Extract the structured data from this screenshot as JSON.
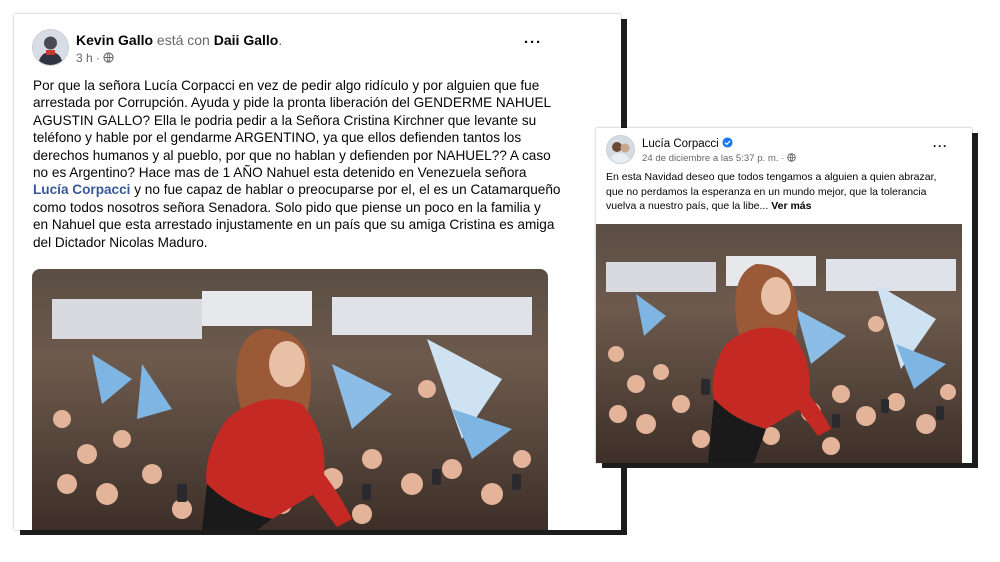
{
  "colors": {
    "link": "#385898",
    "text": "#050505",
    "muted": "#65676b",
    "verified": "#1877f2",
    "jacket_red": "#c42a23",
    "flag_blue": "#7fb5e3"
  },
  "post_left": {
    "author": "Kevin Gallo",
    "with_word": "está con",
    "tagged": "Daii Gallo",
    "period": ".",
    "time": "3 h ·",
    "privacy_icon": "globe-icon",
    "more_icon": "more-options-icon",
    "more_label": "···",
    "text_part1": "Por que la señora Lucía Corpacci en vez de pedir algo ridículo y por alguien que fue\narrestada por Corrupción. Ayuda y pide la pronta  liberación del GENDERME NAHUEL\nAGUSTIN GALLO? Ella le podria pedir a la Señora Cristina Kirchner que levante su\nteléfono y hable por el gendarme ARGENTINO, ya que ellos defienden tantos los\nderechos humanos y al pueblo, por que no hablan y defienden por NAHUEL?? A caso\nno es Argentino? Hace mas de 1 AÑO Nahuel esta detenido en Venezuela señora\n",
    "text_mention": "Lucía Corpacci",
    "text_part2": " y no fue capaz de hablar o preocuparse por el, el es un Catamarqueño\ncomo todos nosotros señora Senadora. Solo pido que piense un poco en la familia y\nen Nahuel que esta arrestado injustamente en un país que su amiga Cristina es amiga\ndel Dictador Nicolas Maduro.",
    "photo_icon": "rally-photo"
  },
  "post_right": {
    "author": "Lucía Corpacci",
    "verified_icon": "verified-badge-icon",
    "date": "24 de diciembre a las 5:37 p. m. ·",
    "privacy_icon": "globe-icon",
    "more_icon": "more-options-icon",
    "more_label": "···",
    "text": "En esta Navidad deseo que todos tengamos a alguien a quien abrazar,\nque no perdamos la esperanza en un mundo mejor, que la tolerancia\nvuelva a nuestro país, que la libe... ",
    "see_more": "Ver más",
    "photo_icon": "rally-photo"
  }
}
